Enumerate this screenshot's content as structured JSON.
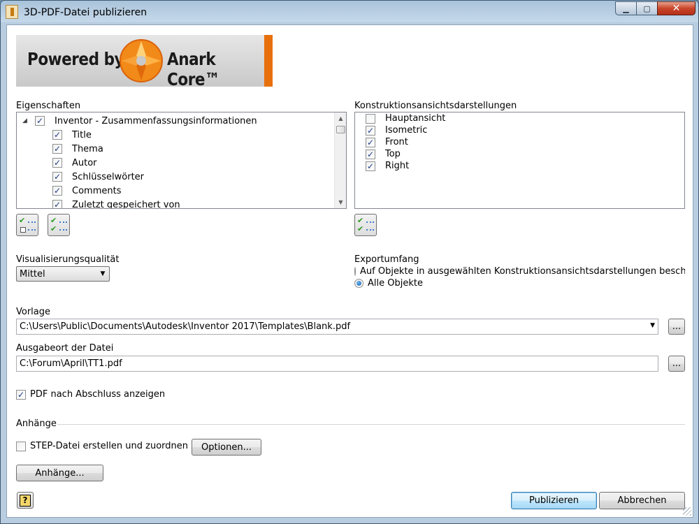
{
  "window": {
    "title": "3D-PDF-Datei publizieren",
    "minimize_glyph": "▁",
    "maximize_glyph": "▢",
    "close_glyph": "✕"
  },
  "logo": {
    "text_left": "Powered by",
    "text_right": "Anark Core™",
    "accent_color": "#e8700c"
  },
  "properties": {
    "label": "Eigenschaften",
    "tree": [
      {
        "label": "Inventor - Zusammenfassungsinformationen",
        "checked": true,
        "level": 0,
        "expanded": true
      },
      {
        "label": "Title",
        "checked": true,
        "level": 1
      },
      {
        "label": "Thema",
        "checked": true,
        "level": 1
      },
      {
        "label": "Autor",
        "checked": true,
        "level": 1
      },
      {
        "label": "Schlüsselwörter",
        "checked": true,
        "level": 1
      },
      {
        "label": "Comments",
        "checked": true,
        "level": 1
      },
      {
        "label": "Zuletzt gespeichert von",
        "checked": true,
        "level": 1
      }
    ]
  },
  "views": {
    "label": "Konstruktionsansichtsdarstellungen",
    "items": [
      {
        "label": "Hauptansicht",
        "checked": false
      },
      {
        "label": "Isometric",
        "checked": true
      },
      {
        "label": "Front",
        "checked": true
      },
      {
        "label": "Top",
        "checked": true
      },
      {
        "label": "Right",
        "checked": true
      }
    ]
  },
  "quality": {
    "label": "Visualisierungsqualität",
    "value": "Mittel"
  },
  "export": {
    "label": "Exportumfang",
    "options": [
      {
        "label": "Auf Objekte in ausgewählten Konstruktionsansichtsdarstellungen beschränken",
        "selected": false
      },
      {
        "label": "Alle Objekte",
        "selected": true
      }
    ]
  },
  "template": {
    "label": "Vorlage",
    "value": "C:\\Users\\Public\\Documents\\Autodesk\\Inventor 2017\\Templates\\Blank.pdf",
    "browse_label": "..."
  },
  "output": {
    "label": "Ausgabeort der Datei",
    "value": "C:\\Forum\\April\\TT1.pdf",
    "browse_label": "..."
  },
  "show_pdf": {
    "label": "PDF nach Abschluss anzeigen",
    "checked": true
  },
  "attachments": {
    "label": "Anhänge",
    "step_label": "STEP-Datei erstellen und zuordnen",
    "step_checked": false,
    "options_label": "Optionen...",
    "attachments_button": "Anhänge..."
  },
  "footer": {
    "help_glyph": "?",
    "publish_label": "Publizieren",
    "cancel_label": "Abbrechen"
  }
}
